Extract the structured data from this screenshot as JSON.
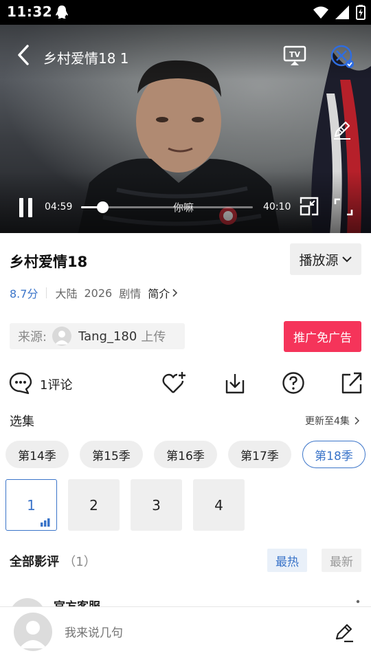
{
  "status_bar": {
    "time": "11:32"
  },
  "player": {
    "title": "乡村爱情18 1",
    "current_time": "04:59",
    "total_time": "40:10",
    "progress": 0.124,
    "subtitle": "你嘛"
  },
  "info": {
    "title": "乡村爱情18",
    "source_button": "播放源",
    "score": "8.7分",
    "region": "大陆",
    "year": "2026",
    "genre": "剧情",
    "intro": "简介"
  },
  "uploader": {
    "label": "来源:",
    "name": "Tang_180",
    "suffix": "上传"
  },
  "promo_button": "推广免广告",
  "actions": {
    "comment_label": "1评论"
  },
  "episodes_section": {
    "title": "选集",
    "update": "更新至4集",
    "seasons": [
      "第14季",
      "第15季",
      "第16季",
      "第17季",
      "第18季"
    ],
    "active_season": 4,
    "episodes": [
      "1",
      "2",
      "3",
      "4"
    ],
    "active_episode": 0
  },
  "reviews": {
    "title": "全部影评",
    "count": "（1）",
    "sort_hot": "最热",
    "sort_new": "最新",
    "first_author": "官方客服"
  },
  "composer": {
    "placeholder": "我来说几句"
  },
  "colors": {
    "accent": "#3a74c9",
    "promo": "#f5345a"
  }
}
